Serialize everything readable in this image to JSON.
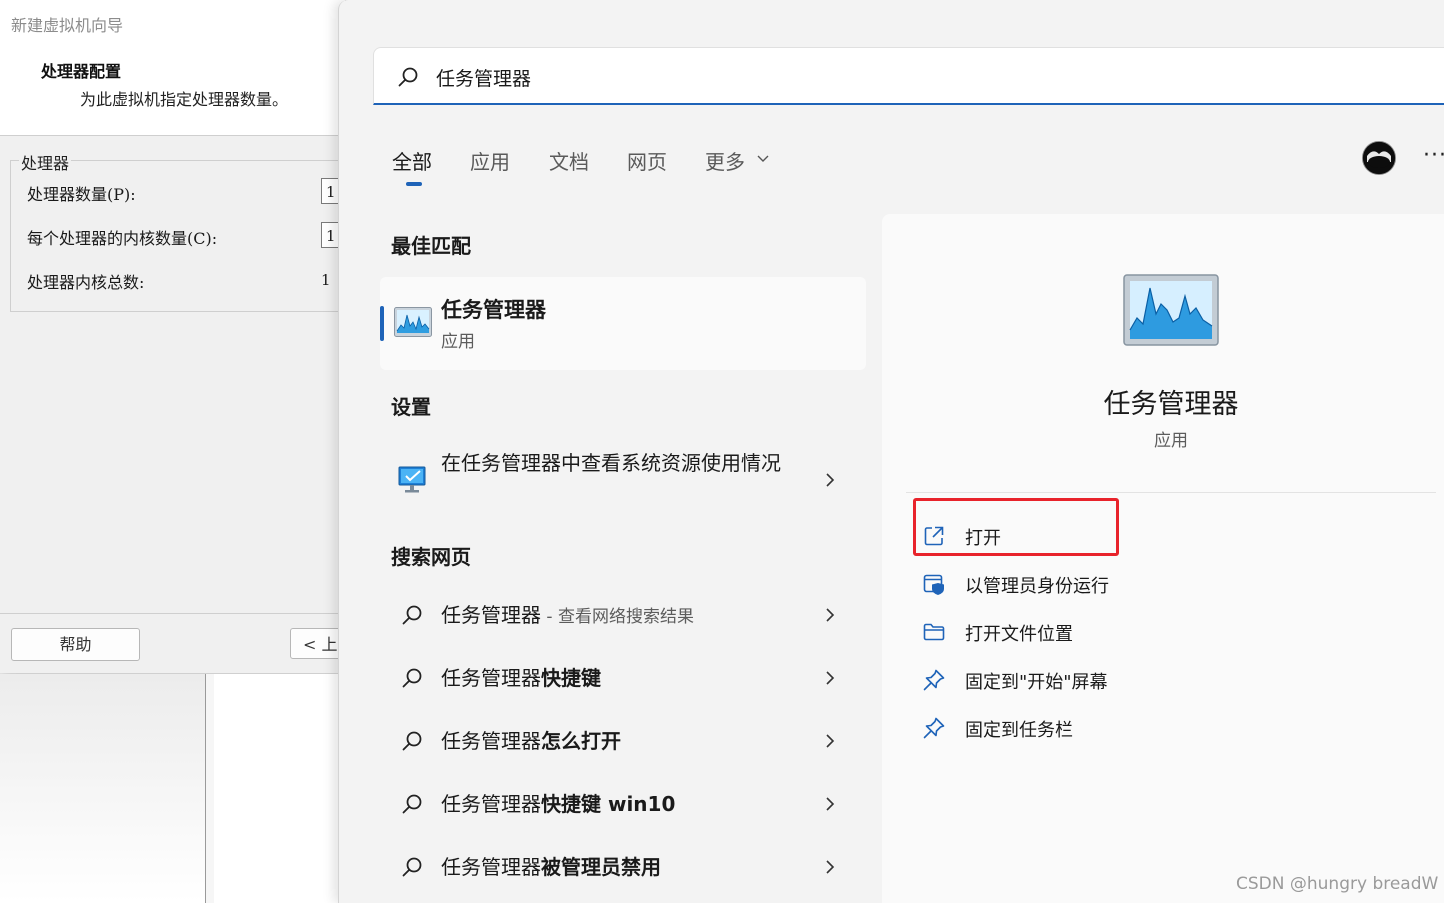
{
  "wizard": {
    "title": "新建虚拟机向导",
    "heading": "处理器配置",
    "description": "为此虚拟机指定处理器数量。",
    "group_label": "处理器",
    "rows": [
      {
        "label": "处理器数量(P):",
        "value": "1"
      },
      {
        "label": "每个处理器的内核数量(C):",
        "value": "1"
      },
      {
        "label": "处理器内核总数:",
        "value": "1"
      }
    ],
    "help_button": "帮助",
    "back_button": "< 上"
  },
  "search": {
    "query": "任务管理器",
    "tabs": [
      "全部",
      "应用",
      "文档",
      "网页",
      "更多"
    ],
    "active_tab": "全部",
    "more_menu": "···"
  },
  "results": {
    "best_match_title": "最佳匹配",
    "best_match": {
      "name": "任务管理器",
      "type": "应用",
      "icon": "task-manager-icon"
    },
    "settings_title": "设置",
    "setting_item": {
      "label": "在任务管理器中查看系统资源使用情况",
      "icon": "monitor-settings-icon"
    },
    "web_title": "搜索网页",
    "web_items": [
      {
        "prefix": "任务管理器",
        "suffix": "",
        "sub": " - 查看网络搜索结果"
      },
      {
        "prefix": "任务管理器",
        "suffix": "快捷键",
        "sub": ""
      },
      {
        "prefix": "任务管理器",
        "suffix": "怎么打开",
        "sub": ""
      },
      {
        "prefix": "任务管理器",
        "suffix": "快捷键 win10",
        "sub": ""
      },
      {
        "prefix": "任务管理器",
        "suffix": "被管理员禁用",
        "sub": ""
      }
    ]
  },
  "detail": {
    "name": "任务管理器",
    "type": "应用",
    "actions": [
      {
        "label": "打开",
        "icon": "open-external-icon"
      },
      {
        "label": "以管理员身份运行",
        "icon": "admin-shield-icon"
      },
      {
        "label": "打开文件位置",
        "icon": "folder-icon"
      },
      {
        "label": "固定到\"开始\"屏幕",
        "icon": "pin-icon"
      },
      {
        "label": "固定到任务栏",
        "icon": "pin-icon"
      }
    ]
  },
  "watermark": "CSDN @hungry breadW",
  "colors": {
    "accent": "#1e63b8",
    "highlight": "#e8232b"
  }
}
